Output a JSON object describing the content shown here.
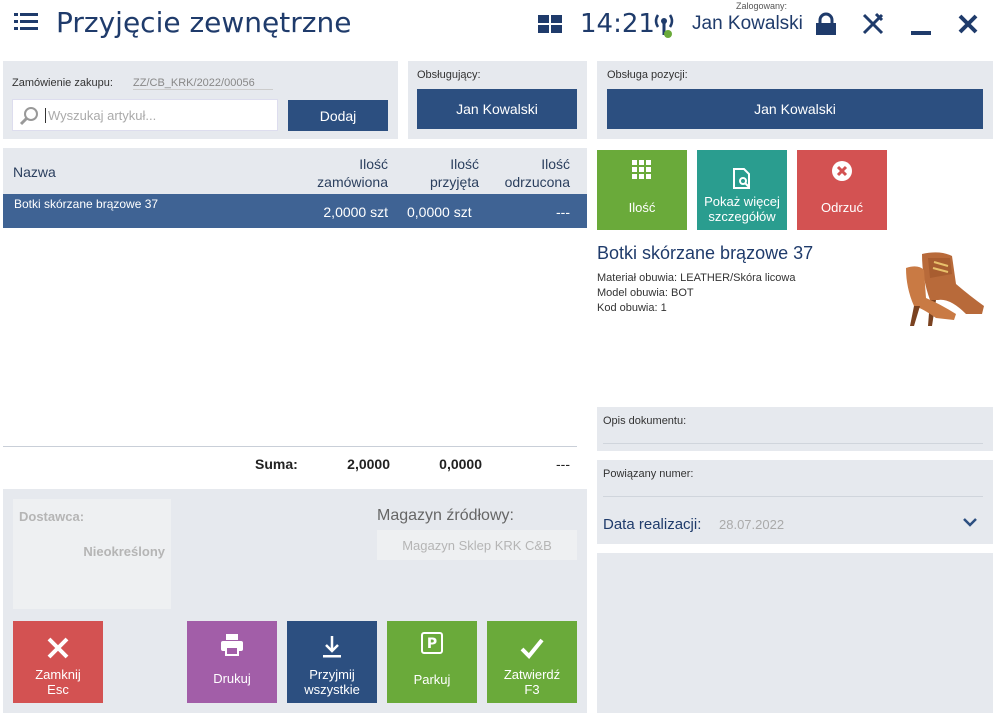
{
  "header": {
    "title": "Przyjęcie zewnętrzne",
    "time": "14:21",
    "logged_label": "Zalogowany:",
    "user": "Jan Kowalski",
    "icons": [
      "menu-icon",
      "grid-icon",
      "signal-icon",
      "lock-icon",
      "tools-icon",
      "minimize-icon",
      "close-icon"
    ]
  },
  "order": {
    "label": "Zamówienie zakupu:",
    "value": "ZZ/CB_KRK/2022/00056",
    "search_placeholder": "Wyszukaj artykuł...",
    "add_button": "Dodaj"
  },
  "handler": {
    "label": "Obsługujący:",
    "value": "Jan Kowalski"
  },
  "position_handler": {
    "label": "Obsługa pozycji:",
    "value": "Jan Kowalski"
  },
  "table": {
    "headers": {
      "name": "Nazwa",
      "ordered_1": "Ilość",
      "ordered_2": "zamówiona",
      "received_1": "Ilość",
      "received_2": "przyjęta",
      "rejected_1": "Ilość",
      "rejected_2": "odrzucona"
    },
    "rows": [
      {
        "name": "Botki skórzane brązowe 37",
        "ordered": "2,0000 szt",
        "received": "0,0000 szt",
        "rejected": "---"
      }
    ],
    "sum_label": "Suma:",
    "sum_ordered": "2,0000",
    "sum_received": "0,0000",
    "sum_rejected": "---"
  },
  "supplier": {
    "label": "Dostawca:",
    "value": "Nieokreślony"
  },
  "source_warehouse": {
    "label": "Magazyn źródłowy:",
    "value": "Magazyn Sklep KRK C&B"
  },
  "actions": {
    "close": "Zamknij",
    "close_key": "Esc",
    "print": "Drukuj",
    "accept_all_1": "Przyjmij",
    "accept_all_2": "wszystkie",
    "park": "Parkuj",
    "confirm": "Zatwierdź",
    "confirm_key": "F3"
  },
  "item_actions": {
    "quantity": "Ilość",
    "details_1": "Pokaż więcej",
    "details_2": "szczegółów",
    "reject": "Odrzuć"
  },
  "product": {
    "name": "Botki skórzane brązowe 37",
    "attr1": "Materiał obuwia: LEATHER/Skóra licowa",
    "attr2": "Model obuwia: BOT",
    "attr3": "Kod obuwia: 1"
  },
  "doc_desc": {
    "label": "Opis dokumentu:"
  },
  "related": {
    "label": "Powiązany numer:"
  },
  "realization": {
    "label": "Data realizacji:",
    "value": "28.07.2022"
  },
  "colors": {
    "navy": "#2c4f80",
    "green": "#6aaa3a",
    "teal": "#2a9d8f",
    "red": "#d35252",
    "purple": "#a25ea8"
  }
}
